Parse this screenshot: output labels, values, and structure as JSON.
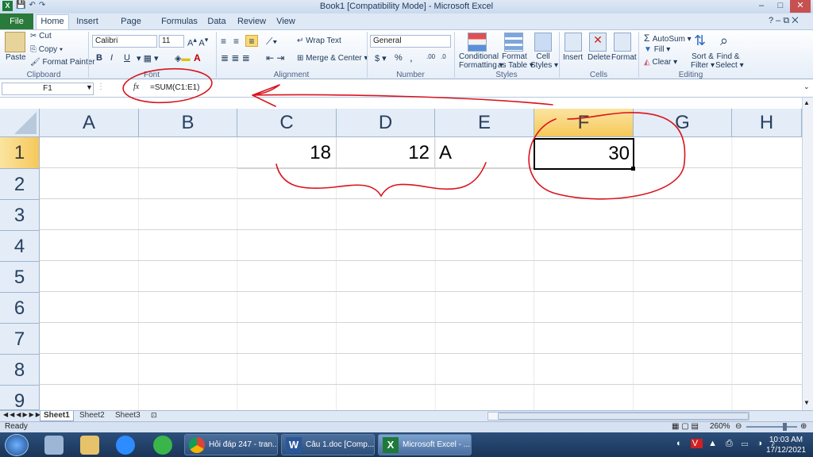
{
  "window": {
    "title": "Book1  [Compatibility Mode]  -  Microsoft Excel",
    "controls": [
      "–",
      "□",
      "✕"
    ]
  },
  "tabs": [
    "File",
    "Home",
    "Insert",
    "Page Layout",
    "Formulas",
    "Data",
    "Review",
    "View"
  ],
  "ribbon": {
    "clipboard": {
      "paste": "Paste",
      "cut": "Cut",
      "copy": "Copy ▾",
      "format_painter": "Format Painter",
      "label": "Clipboard"
    },
    "font": {
      "name": "Calibri",
      "size": "11",
      "bold": "B",
      "italic": "I",
      "underline": "U",
      "label": "Font"
    },
    "alignment": {
      "wrap": "Wrap Text",
      "merge": "Merge & Center ▾",
      "label": "Alignment"
    },
    "number": {
      "format": "General",
      "currency": "$ ▾",
      "percent": "%",
      "comma": ",",
      "inc": ".00",
      "dec": ".0",
      "label": "Number"
    },
    "styles": {
      "cond1": "Conditional",
      "cond2": "Formatting ▾",
      "fmt1": "Format",
      "fmt2": "as Table ▾",
      "cell1": "Cell",
      "cell2": "Styles ▾",
      "label": "Styles"
    },
    "cells": {
      "insert": "Insert",
      "delete": "Delete",
      "format": "Format",
      "label": "Cells"
    },
    "editing": {
      "autosum": "AutoSum ▾",
      "fill": "Fill ▾",
      "clear": "Clear ▾",
      "sort1": "Sort &",
      "sort2": "Filter ▾",
      "find1": "Find &",
      "find2": "Select ▾",
      "label": "Editing"
    }
  },
  "formula_bar": {
    "name_box": "F1",
    "fx": "fx",
    "formula": "=SUM(C1:E1)"
  },
  "columns": [
    "A",
    "B",
    "C",
    "D",
    "E",
    "F",
    "G",
    "H"
  ],
  "rows": [
    "1",
    "2",
    "3",
    "4",
    "5",
    "6",
    "7",
    "8",
    "9"
  ],
  "cells": {
    "C1": "18",
    "D1": "12",
    "E1": "A",
    "F1": "30"
  },
  "sheets": [
    "Sheet1",
    "Sheet2",
    "Sheet3"
  ],
  "status": {
    "ready": "Ready",
    "zoom": "260%"
  },
  "taskbar": {
    "items": [
      "Hỏi đáp 247 - tran...",
      "Câu 1.doc [Comp...",
      "Microsoft Excel - ..."
    ],
    "time": "10:03 AM",
    "date": "17/12/2021"
  },
  "colors": {
    "accent": "#2a7a3b",
    "selected_header": "#f9d976",
    "annotation": "#d9141e"
  }
}
